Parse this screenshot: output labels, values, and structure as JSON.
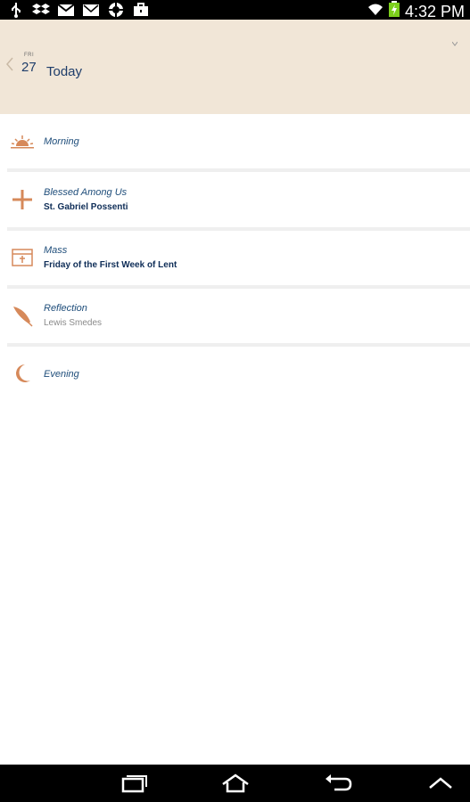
{
  "status_bar": {
    "time": "4:32 PM",
    "left_icons": [
      "usb-icon",
      "dropbox-icon",
      "gmail-icon",
      "mail-icon",
      "sync-icon",
      "briefcase-icon"
    ],
    "right_icons": [
      "wifi-icon",
      "battery-icon"
    ]
  },
  "header": {
    "day_of_week": "FRI",
    "day_number": "27",
    "title": "Today"
  },
  "items": [
    {
      "icon": "sunrise-icon",
      "title": "Morning",
      "subtitle": ""
    },
    {
      "icon": "cross-icon",
      "title": "Blessed Among Us",
      "subtitle": "St. Gabriel Possenti"
    },
    {
      "icon": "chalice-box-icon",
      "title": "Mass",
      "subtitle": "Friday of the First Week of Lent"
    },
    {
      "icon": "quill-icon",
      "title": "Reflection",
      "subtitle": "Lewis Smedes"
    },
    {
      "icon": "moon-icon",
      "title": "Evening",
      "subtitle": ""
    }
  ],
  "nav_bar": {
    "buttons": [
      "recent-apps-icon",
      "home-icon",
      "back-icon",
      "menu-up-icon"
    ]
  },
  "colors": {
    "header_bg": "#f1e6d7",
    "accent_icon": "#d6895a",
    "title_text": "#1e3d6a"
  }
}
